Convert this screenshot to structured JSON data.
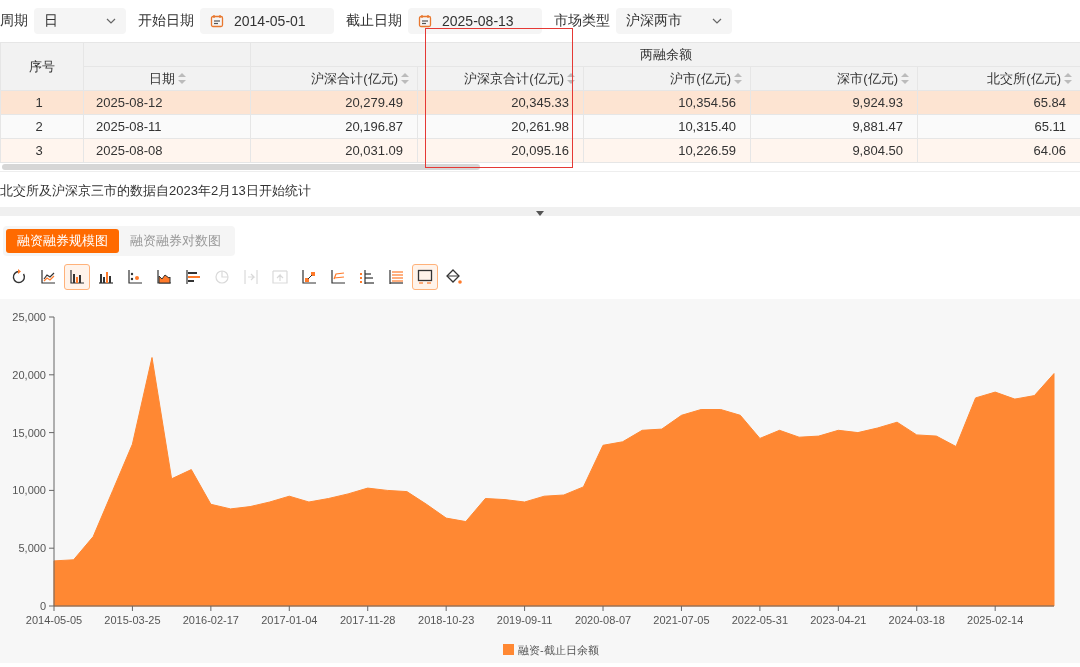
{
  "filters": [
    {
      "label": "周期",
      "value": "日",
      "kind": "select"
    },
    {
      "label": "开始日期",
      "value": "2014-05-01",
      "kind": "date"
    },
    {
      "label": "截止日期",
      "value": "2025-08-13",
      "kind": "date"
    },
    {
      "label": "市场类型",
      "value": "沪深两市",
      "kind": "select"
    }
  ],
  "table": {
    "index_header": "序号",
    "group_header": "两融余额",
    "columns": [
      "日期",
      "沪深合计(亿元)",
      "沪深京合计(亿元)",
      "沪市(亿元)",
      "深市(亿元)",
      "北交所(亿元)"
    ],
    "rows": [
      {
        "index": "1",
        "cells": [
          "2025-08-12",
          "20,279.49",
          "20,345.33",
          "10,354.56",
          "9,924.93",
          "65.84"
        ],
        "selected": true
      },
      {
        "index": "2",
        "cells": [
          "2025-08-11",
          "20,196.87",
          "20,261.98",
          "10,315.40",
          "9,881.47",
          "65.11"
        ],
        "selected": false
      },
      {
        "index": "3",
        "cells": [
          "2025-08-08",
          "20,031.09",
          "20,095.16",
          "10,226.59",
          "9,804.50",
          "64.06"
        ],
        "selected": false
      }
    ]
  },
  "note": "北交所及沪深京三市的数据自2023年2月13日开始统计",
  "chart_tabs": [
    {
      "label": "融资融券规模图",
      "selected": true
    },
    {
      "label": "融资融券对数图",
      "selected": false
    }
  ],
  "tools": [
    {
      "kind": "refresh",
      "selected": false,
      "disabled": false
    },
    {
      "kind": "line",
      "selected": false,
      "disabled": false
    },
    {
      "kind": "bar",
      "selected": true,
      "disabled": false
    },
    {
      "kind": "bar2",
      "selected": false,
      "disabled": false
    },
    {
      "kind": "scatter",
      "selected": false,
      "disabled": false
    },
    {
      "kind": "area",
      "selected": false,
      "disabled": false
    },
    {
      "kind": "hbar",
      "selected": false,
      "disabled": false
    },
    {
      "kind": "pie",
      "selected": false,
      "disabled": true
    },
    {
      "kind": "arrow-right",
      "selected": false,
      "disabled": true
    },
    {
      "kind": "arrow-up",
      "selected": false,
      "disabled": true
    },
    {
      "kind": "step",
      "selected": false,
      "disabled": false
    },
    {
      "kind": "lines",
      "selected": false,
      "disabled": false
    },
    {
      "kind": "dots",
      "selected": false,
      "disabled": false
    },
    {
      "kind": "rows",
      "selected": false,
      "disabled": false
    },
    {
      "kind": "screen",
      "selected": true,
      "disabled": false
    },
    {
      "kind": "fill",
      "selected": false,
      "disabled": false
    }
  ],
  "chart_data": {
    "type": "area",
    "categories": [
      "2014-05-05",
      null,
      null,
      null,
      "2015-03-25",
      null,
      null,
      null,
      "2016-02-17",
      null,
      null,
      null,
      "2017-01-04",
      null,
      null,
      null,
      "2017-11-28",
      null,
      null,
      null,
      "2018-10-23",
      null,
      null,
      null,
      "2019-09-11",
      null,
      null,
      null,
      "2020-08-07",
      null,
      null,
      null,
      "2021-07-05",
      null,
      null,
      null,
      "2022-05-31",
      null,
      null,
      null,
      "2023-04-21",
      null,
      null,
      null,
      "2024-03-18",
      null,
      null,
      null,
      "2025-02-14",
      null,
      null,
      null
    ],
    "series": [
      {
        "name": "融资-截止日余额",
        "color": "#ff8833",
        "values": [
          3900,
          4000,
          6000,
          10000,
          14000,
          21500,
          11000,
          11800,
          8800,
          8400,
          8600,
          9000,
          9500,
          9000,
          9300,
          9700,
          10200,
          10000,
          9900,
          8800,
          7600,
          7300,
          9300,
          9200,
          9000,
          9500,
          9600,
          10300,
          13900,
          14200,
          15200,
          15300,
          16500,
          17000,
          17000,
          16500,
          14500,
          15200,
          14600,
          14700,
          15200,
          15000,
          15400,
          15900,
          14800,
          14700,
          13800,
          18000,
          18500,
          17900,
          18200,
          20100
        ]
      }
    ],
    "ylim": [
      0,
      25000
    ],
    "yticks": [
      {
        "value": 0,
        "label": "0"
      },
      {
        "value": 5000,
        "label": "5,000"
      },
      {
        "value": 10000,
        "label": "10,000"
      },
      {
        "value": 15000,
        "label": "15,000"
      },
      {
        "value": 20000,
        "label": "20,000"
      },
      {
        "value": 25000,
        "label": "25,000"
      }
    ]
  }
}
